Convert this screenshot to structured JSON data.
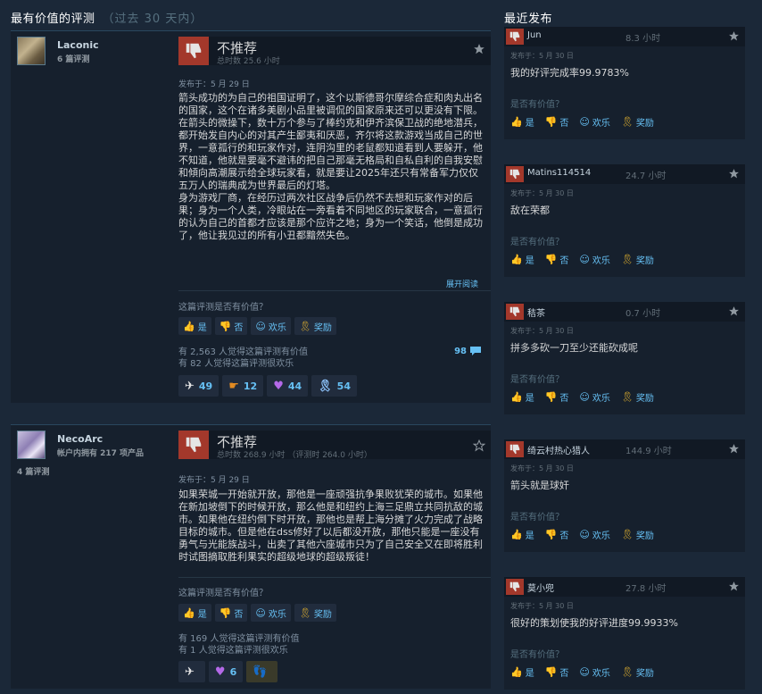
{
  "headings": {
    "most_helpful": "最有价值的评测",
    "most_helpful_sub": "（过去 30 天内）",
    "recent": "最近发布"
  },
  "reviews": [
    {
      "author": "Laconic",
      "author_meta": "6 篇评测",
      "author_meta2": "",
      "verdict": "不推荐",
      "hours": "总时数 25.6 小时",
      "posted": "发布于：5 月 29 日",
      "text": "箭头成功的为自己的祖国证明了，这个以斯德哥尔摩综合症和肉丸出名的国家，这个在诸多美剧小品里被调侃的国家原来还可以更没有下限。\n在箭头的微操下，数十万个参与了棒约克和伊齐滨保卫战的绝地潜兵，都开始发自内心的对其产生鄙夷和厌恶，齐尔将这款游戏当成自己的世界，一意孤行的和玩家作对，连阴沟里的老鼠都知道看到人要躲开，他不知道，他就是要毫不避讳的把自己那毫无格局和自私自利的自我安慰和傾向高潮展示给全球玩家看，就是要让2025年还只有常备军力仅仅五万人的瑞典成为世界最后的灯塔。\n身为游戏厂商，在经历过两次社区战争后仍然不去想和玩家作对的后果；身为一个人类，冷眼站在一旁看着不同地区的玩家联合，一意孤行的认为自己的首都才应该是那个应许之地；身为一个笑话，他倒是成功了，他让我见过的所有小丑都黯然失色。",
      "read_more": "展开阅读",
      "helpful_q": "这篇评测是否有价值？",
      "votes": [
        "是",
        "否",
        "欢乐",
        "奖励"
      ],
      "stats": [
        "有 2,563 人觉得这篇评测有价值",
        "有 82 人觉得这篇评测很欢乐"
      ],
      "comments": "98",
      "awards": [
        "49",
        "12",
        "44",
        "54"
      ]
    },
    {
      "author": "NecoArc",
      "author_meta": "帐户内拥有 217 项产品",
      "author_meta2": "4 篇评测",
      "verdict": "不推荐",
      "hours": "总时数 268.9 小时  （评测时 264.0 小时）",
      "posted": "发布于：5 月 29 日",
      "text": "如果荣城一开始就开放，那他是一座顽强抗争果败犹荣的城市。如果他在新加坡倒下的时候开放，那么他是和纽约上海三足鼎立共同抗敌的城市。如果他在纽约倒下时开放，那他也是帮上海分摊了火力完成了战略目标的城市。但是他在dss修好了以后都没开放，那他只能是一座没有勇气与光能族战斗，出卖了其他六座城市只为了自己安全又在即将胜利时试图摘取胜利果实的超级地球的超级叛徒！",
      "helpful_q": "这篇评测是否有价值？",
      "votes": [
        "是",
        "否",
        "欢乐",
        "奖励"
      ],
      "stats": [
        "有 169 人觉得这篇评测有价值",
        "有 1 人觉得这篇评测很欢乐"
      ],
      "awards": [
        "",
        "6",
        ""
      ]
    }
  ],
  "recent": [
    {
      "name": "Jun",
      "hours": "8.3 小时",
      "posted": "发布于：5 月 30 日",
      "text": "我的好评完成率99.9783%",
      "q": "是否有价值？",
      "votes": [
        "是",
        "否",
        "欢乐",
        "奖励"
      ]
    },
    {
      "name": "Matins114514",
      "hours": "24.7 小时",
      "posted": "发布于：5 月 30 日",
      "text": "敌在荣都",
      "q": "是否有价值？",
      "votes": [
        "是",
        "否",
        "欢乐",
        "奖励"
      ]
    },
    {
      "name": "秸茶",
      "hours": "0.7 小时",
      "posted": "发布于：5 月 30 日",
      "text": "拼多多砍一刀至少还能砍成呢",
      "q": "是否有价值？",
      "votes": [
        "是",
        "否",
        "欢乐",
        "奖励"
      ]
    },
    {
      "name": "绮云村热心猎人",
      "hours": "144.9 小时",
      "posted": "发布于：5 月 30 日",
      "text": "箭头就是球奸",
      "q": "是否有价值？",
      "votes": [
        "是",
        "否",
        "欢乐",
        "奖励"
      ]
    },
    {
      "name": "莫小兜",
      "hours": "27.8 小时",
      "posted": "发布于：5 月 30 日",
      "text": "很好的策划使我的好评进度99.9933%",
      "q": "是否有价值？",
      "votes": [
        "是",
        "否",
        "欢乐",
        "奖励"
      ]
    }
  ],
  "colors": {
    "thumbs_down": "#a3382b",
    "link": "#66c0f4",
    "award_gold": "#e3b22e",
    "bg": "#1b2838"
  },
  "icons": {
    "thumb_down": "thumbs-down-icon",
    "star": "star-icon",
    "comment": "comment-bubble-icon"
  }
}
